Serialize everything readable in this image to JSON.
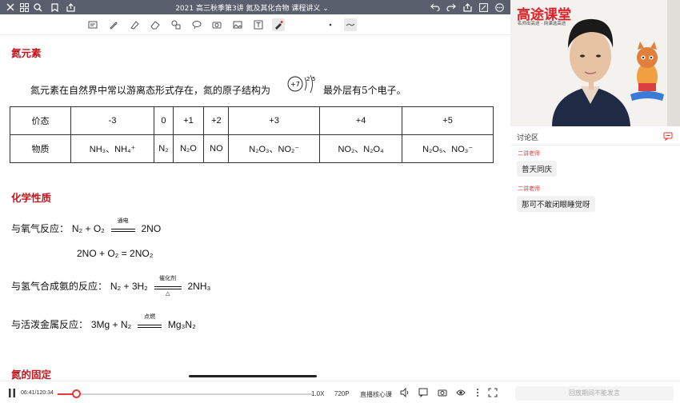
{
  "header": {
    "title": "2021 高三秋季第3讲 氮及其化合物 课程讲义 ⌄"
  },
  "document": {
    "heading_nitrogen": "氮元素",
    "intro_text_a": "氮元素在自然界中常以游离态形式存在，氮的原子结构为",
    "intro_text_b": "最外层有5个电子。",
    "atom": {
      "nucleus": "+7",
      "shell1": "2",
      "shell2": "5"
    },
    "table": {
      "row_headers": [
        "价态",
        "物质"
      ],
      "valences": [
        "-3",
        "0",
        "+1",
        "+2",
        "+3",
        "+4",
        "+5"
      ],
      "substances": [
        "NH₃、NH₄⁺",
        "N₂",
        "N₂O",
        "NO",
        "N₂O₃、NO₂⁻",
        "NO₂、N₂O₄",
        "N₂O₅、NO₃⁻"
      ]
    },
    "heading_chem": "化学性质",
    "rx_oxygen_label": "与氧气反应：",
    "rx_oxygen_left": "N₂ + O₂",
    "rx_oxygen_cond": "通电",
    "rx_oxygen_right": "2NO",
    "rx_no_line": "2NO + O₂ = 2NO₂",
    "rx_hydrogen_label": "与氢气合成氨的反应：",
    "rx_hydrogen_left": "N₂ + 3H₂",
    "rx_hydrogen_cond": "催化剂",
    "rx_hydrogen_below": "△",
    "rx_hydrogen_right": "2NH₃",
    "rx_metal_label": "与活泼金属反应：",
    "rx_metal_left": "3Mg + N₂",
    "rx_metal_cond": "点燃",
    "rx_metal_right": "Mg₃N₂",
    "heading_fixation": "氮的固定"
  },
  "player": {
    "time": "06:41/120:34",
    "progress": 0.072,
    "speed": "1.0X",
    "quality": "720P",
    "mode": "直播核心课"
  },
  "video": {
    "brand": "高途课堂",
    "slogan": "名师出高途 · 网课选高途"
  },
  "chat": {
    "title": "讨论区",
    "messages": [
      {
        "name": "二讲老师",
        "text": "普天同庆"
      },
      {
        "name": "二讲老师",
        "text": "那可不敢闭眼睡觉呀"
      }
    ],
    "input_placeholder": "回放期间不能发言"
  },
  "colors": {
    "topbar": "#5a5f6d",
    "heading_red": "#c8141c",
    "accent": "#e53935"
  }
}
